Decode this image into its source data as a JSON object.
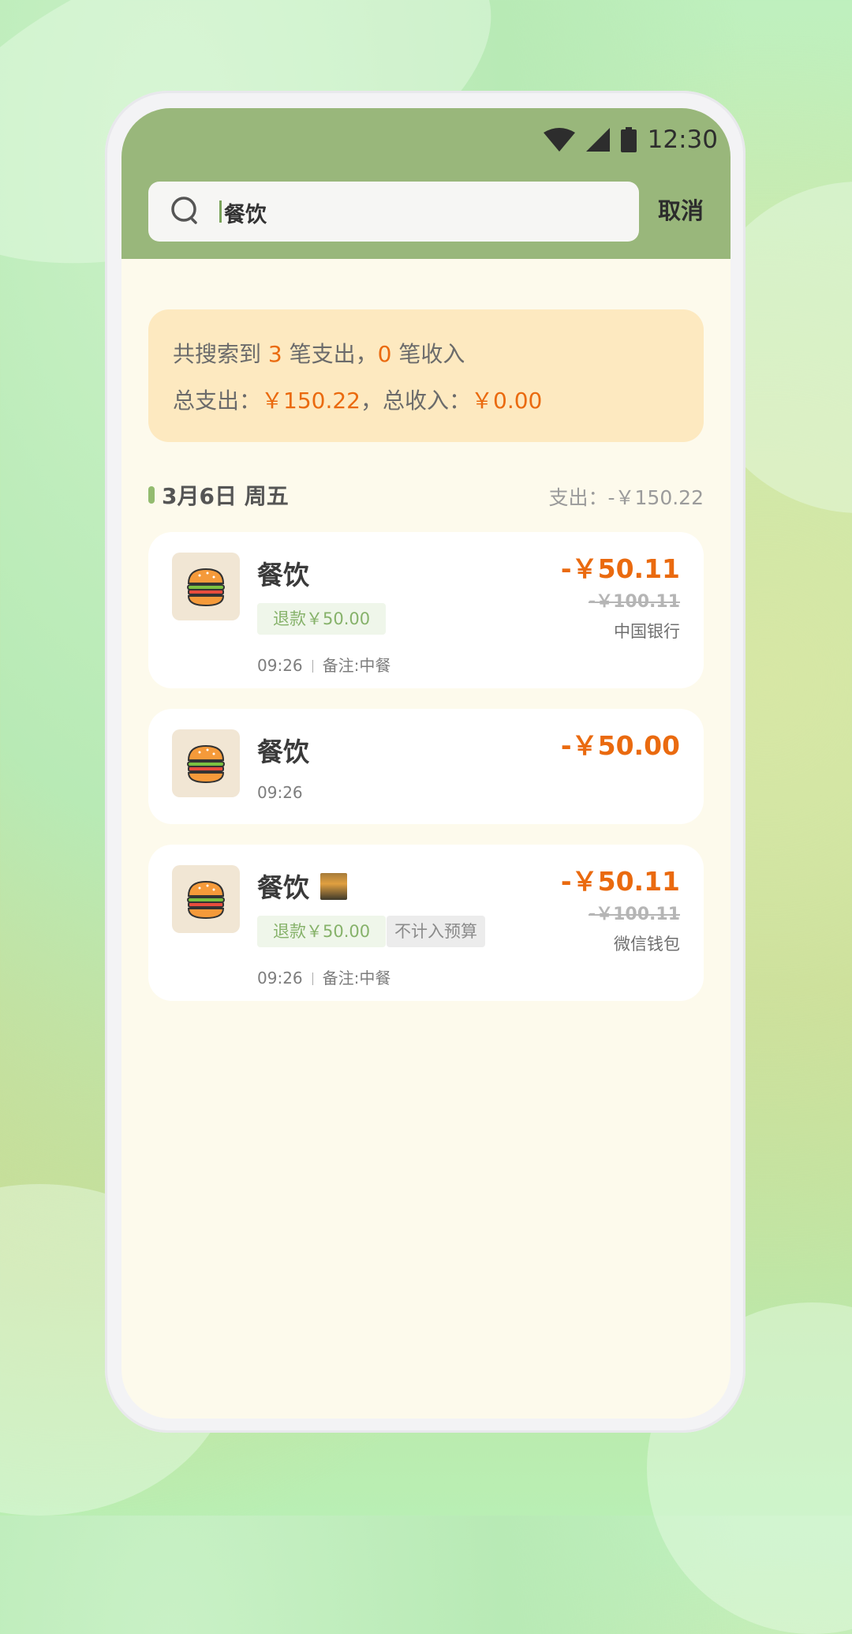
{
  "status_bar": {
    "time": "12:30",
    "icons": [
      "wifi-icon",
      "signal-icon",
      "battery-icon"
    ]
  },
  "search": {
    "query": "餐饮",
    "cancel_label": "取消",
    "icon": "search-icon"
  },
  "summary": {
    "line1_prefix": "共搜索到 ",
    "expense_count": "3",
    "line1_mid": " 笔支出，",
    "income_count": "0",
    "line1_suffix": " 笔收入",
    "total_expense_label": "总支出：",
    "total_expense": "￥150.22",
    "sep": "，",
    "total_income_label": "总收入：",
    "total_income": "￥0.00"
  },
  "day_group": {
    "date": "3月6日  周五",
    "expense_summary": "支出：-￥150.22"
  },
  "records": [
    {
      "category": "餐饮",
      "icon": "burger-icon",
      "refund_tag": "退款￥50.00",
      "time": "09:26",
      "note": "备注:中餐",
      "amount": "-￥50.11",
      "original_amount": "-￥100.11",
      "account": "中国银行"
    },
    {
      "category": "餐饮",
      "icon": "burger-icon",
      "time": "09:26",
      "amount": "-￥50.00"
    },
    {
      "category": "餐饮",
      "icon": "burger-icon",
      "refund_tag": "退款￥50.00",
      "budget_tag": "不计入预算",
      "time": "09:26",
      "note": "备注:中餐",
      "amount": "-￥50.11",
      "original_amount": "-￥100.11",
      "account": "微信钱包"
    }
  ],
  "colors": {
    "header": "#99b77b",
    "accent_orange": "#ea6a0f",
    "summary_bg": "#fde9c0",
    "screen_bg": "#fdfaec"
  }
}
